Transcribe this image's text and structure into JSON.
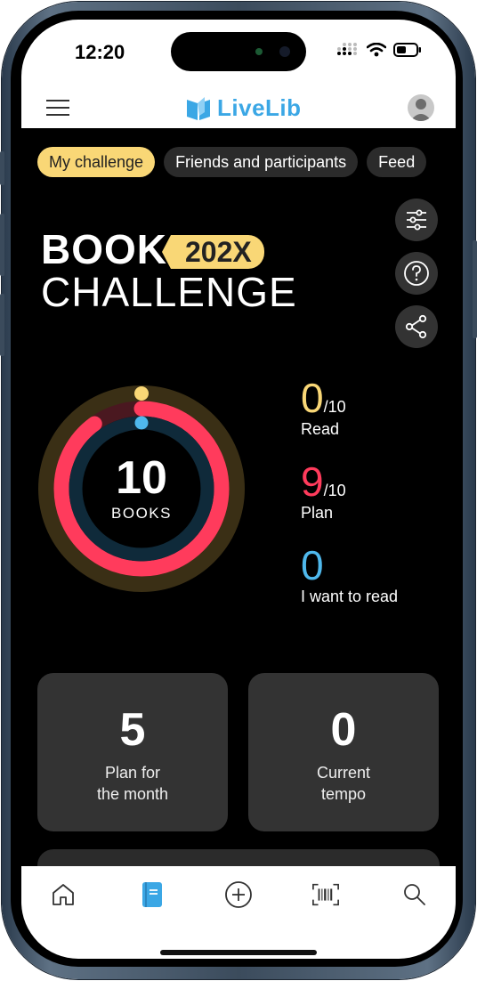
{
  "status": {
    "time": "12:20"
  },
  "app": {
    "logo_text": "LiveLib"
  },
  "tabs": [
    {
      "label": "My challenge",
      "active": true
    },
    {
      "label": "Friends and participants",
      "active": false
    },
    {
      "label": "Feed",
      "active": false
    }
  ],
  "challenge": {
    "title_line1": "BOOK",
    "year": "202X",
    "title_line2": "CHALLENGE",
    "goal_number": "10",
    "goal_label": "BOOKS"
  },
  "stats": [
    {
      "value": "0",
      "of": "/10",
      "label": "Read",
      "color": "#f9d776"
    },
    {
      "value": "9",
      "of": "/10",
      "label": "Plan",
      "color": "#ff3b5c"
    },
    {
      "value": "0",
      "of": "",
      "label": "I want to read",
      "color": "#4fb8ec"
    }
  ],
  "progress": {
    "read_fraction": 0.0,
    "plan_fraction": 0.9,
    "want_fraction": 0.0
  },
  "cards": [
    {
      "value": "5",
      "label": "Plan for\nthe month"
    },
    {
      "value": "0",
      "label": "Current\ntempo"
    }
  ],
  "icons": {
    "settings": "sliders-icon",
    "help": "question-icon",
    "share": "share-icon",
    "tabbar": [
      "home-icon",
      "book-icon",
      "add-icon",
      "barcode-icon",
      "search-icon"
    ]
  },
  "colors": {
    "accent_yellow": "#f9d776",
    "accent_red": "#ff3b5c",
    "accent_blue": "#4fb8ec",
    "brand_blue": "#3ba7e5"
  }
}
